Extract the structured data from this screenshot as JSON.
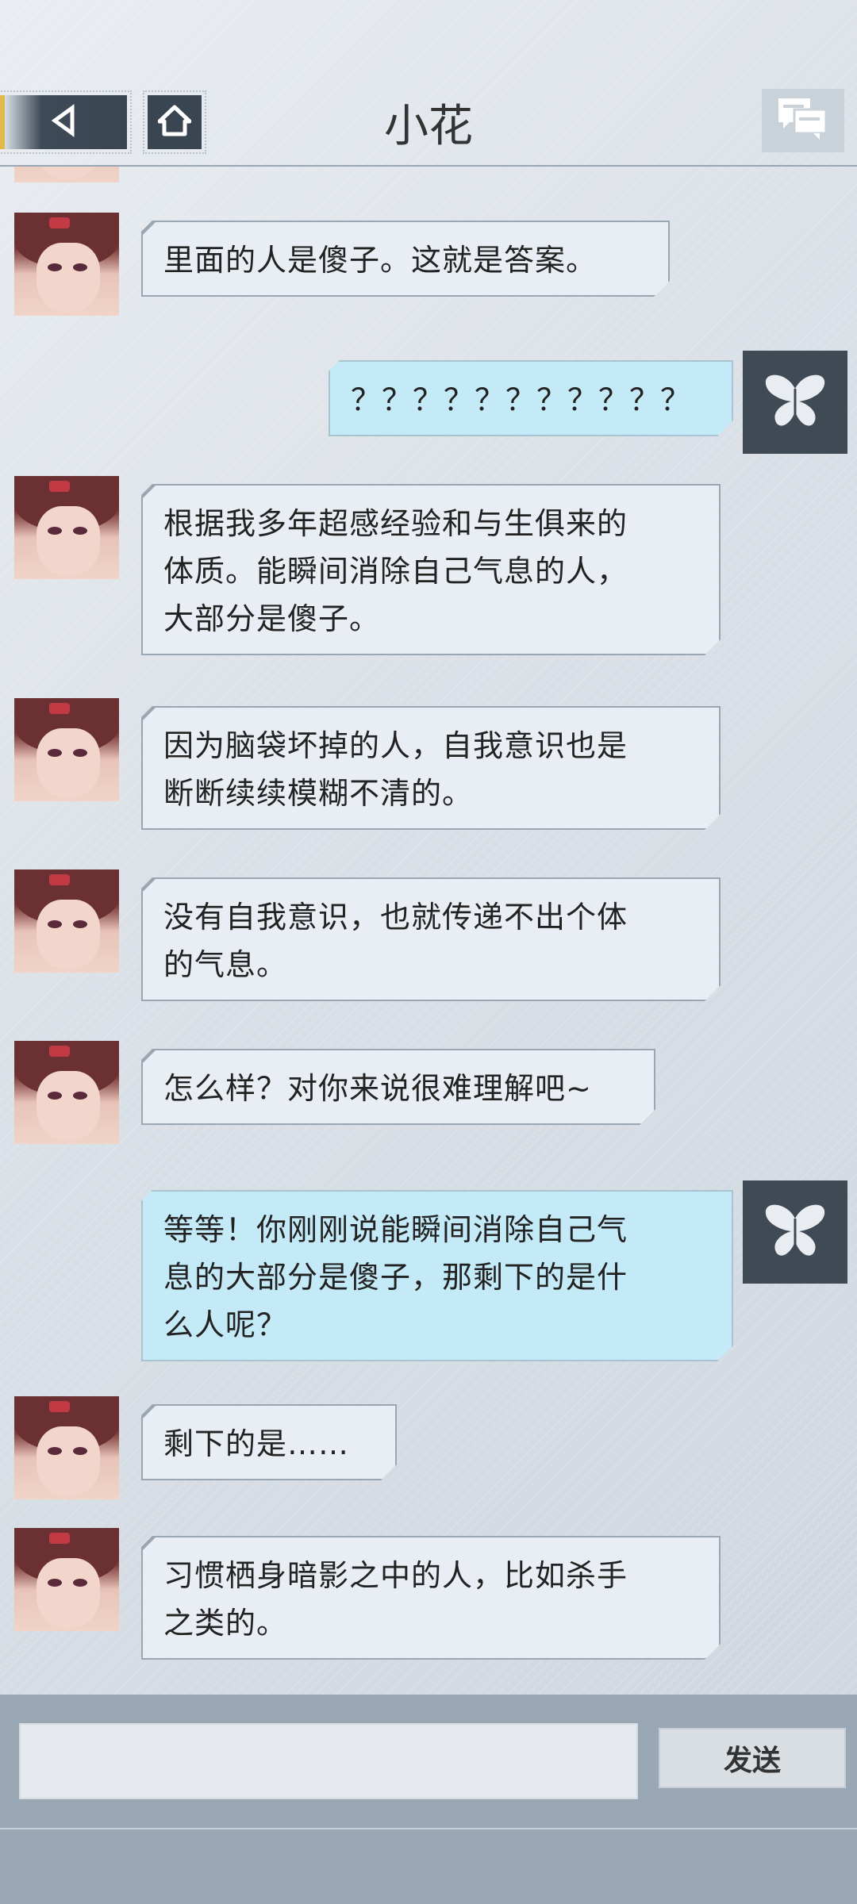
{
  "header": {
    "title": "小花"
  },
  "messages": [
    {
      "side": "left",
      "text": "里面的人是傻子。这就是答案。"
    },
    {
      "side": "right",
      "text": "？？？？？？？？？？？"
    },
    {
      "side": "left",
      "text": "根据我多年超感经验和与生俱来的\n体质。能瞬间消除自己气息的人，\n大部分是傻子。"
    },
    {
      "side": "left",
      "text": "因为脑袋坏掉的人，自我意识也是\n断断续续模糊不清的。"
    },
    {
      "side": "left",
      "text": "没有自我意识，也就传递不出个体\n的气息。"
    },
    {
      "side": "left",
      "text": "怎么样？对你来说很难理解吧~"
    },
    {
      "side": "right",
      "text": "等等！你刚刚说能瞬间消除自己气\n息的大部分是傻子，那剩下的是什\n么人呢？"
    },
    {
      "side": "left",
      "text": "剩下的是……"
    },
    {
      "side": "left",
      "text": "习惯栖身暗影之中的人，比如杀手\n之类的。"
    }
  ],
  "composer": {
    "input_value": "",
    "send_label": "发送"
  },
  "icons": {
    "back": "back-arrow-icon",
    "home": "home-icon",
    "chat": "chat-bubbles-icon",
    "player_avatar": "butterfly-icon"
  },
  "colors": {
    "incoming_bubble": "#e9eef4",
    "outgoing_bubble": "#c4e9f7",
    "header_button": "#3a4552"
  }
}
